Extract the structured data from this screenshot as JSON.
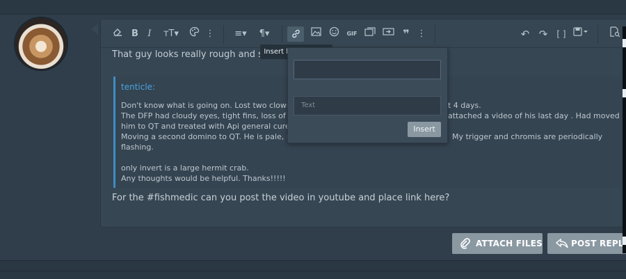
{
  "toolbar": {
    "bold_label": "B",
    "italic_label": "I",
    "text_size_label": "тT▾",
    "align_label": "≡▾",
    "paragraph_label": "¶▾",
    "gif_label": "GIF",
    "more_label": "⋮",
    "brackets_label": "[ ]"
  },
  "post": {
    "line1": "That guy looks really rough and sh"
  },
  "quote": {
    "author": "tenticle:",
    "lines": [
      "Don't know what is going on.  Lost two clown",
      "The DFP had cloudy eyes, tight fins, loss of ap",
      "him to QT and treated with Api general cure.",
      "Moving a second domino to QT. He is pale, ra",
      "flashing.",
      "",
      "only invert is a large hermit crab.",
      "Any thoughts would be helpful.  Thanks!!!!!"
    ],
    "tail_1": "t 4 days.",
    "tail_2": "attached a video of his last day . Had moved",
    "tail_4": "My trigger and chromis are periodically"
  },
  "reply": {
    "text": "For the #fishmedic can you post the video in youtube and place link here?"
  },
  "tooltip": {
    "text": "Insert link (Ctrl+K)"
  },
  "link_popup": {
    "url_value": "",
    "text_placeholder": "Text",
    "insert_label": "Insert"
  },
  "actions": {
    "attach_label": "ATTACH FILES",
    "post_label": "POST REPLY"
  },
  "colors": {
    "background": "#2f3e4a",
    "editor": "#364653",
    "quote_border": "#3e8dc3",
    "button": "#8a98a2"
  }
}
